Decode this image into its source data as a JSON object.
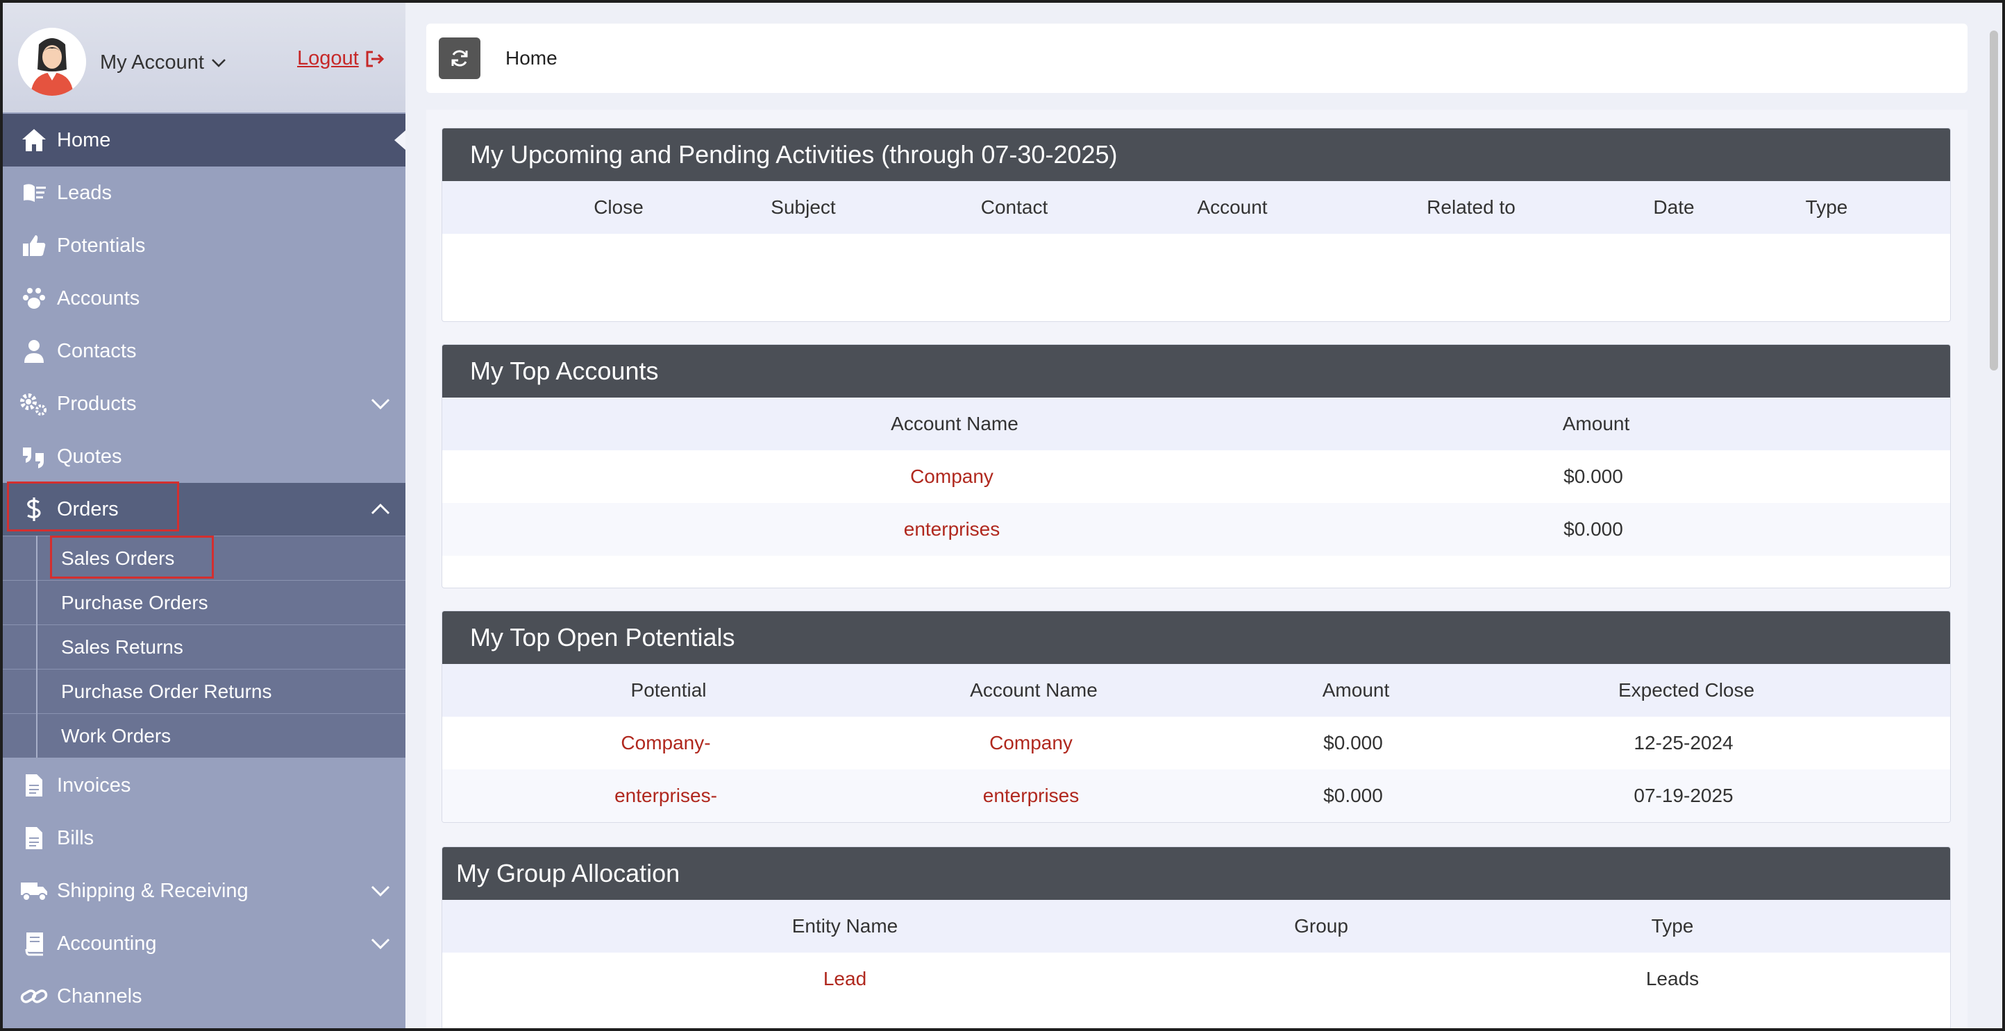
{
  "account": {
    "my_account_label": "My Account",
    "logout_label": "Logout"
  },
  "sidebar": {
    "items": [
      {
        "label": "Home",
        "icon": "home-icon"
      },
      {
        "label": "Leads",
        "icon": "leads-icon"
      },
      {
        "label": "Potentials",
        "icon": "thumbs-up-icon"
      },
      {
        "label": "Accounts",
        "icon": "paw-icon"
      },
      {
        "label": "Contacts",
        "icon": "person-icon"
      },
      {
        "label": "Products",
        "icon": "gears-icon"
      },
      {
        "label": "Quotes",
        "icon": "quote-icon"
      },
      {
        "label": "Orders",
        "icon": "dollar-icon"
      },
      {
        "label": "Invoices",
        "icon": "document-icon"
      },
      {
        "label": "Bills",
        "icon": "document-icon"
      },
      {
        "label": "Shipping & Receiving",
        "icon": "truck-icon"
      },
      {
        "label": "Accounting",
        "icon": "book-icon"
      },
      {
        "label": "Channels",
        "icon": "link-icon"
      }
    ],
    "orders_sub": [
      "Sales Orders",
      "Purchase Orders",
      "Sales Returns",
      "Purchase Order Returns",
      "Work Orders"
    ]
  },
  "breadcrumb": {
    "current": "Home"
  },
  "activities": {
    "title": "My Upcoming and Pending Activities (through 07-30-2025)",
    "columns": [
      "Close",
      "Subject",
      "Contact",
      "Account",
      "Related to",
      "Date",
      "Type"
    ]
  },
  "top_accounts": {
    "title": "My Top Accounts",
    "columns": [
      "Account Name",
      "Amount"
    ],
    "rows": [
      {
        "name": "Company",
        "amount": "$0.000"
      },
      {
        "name": "enterprises",
        "amount": "$0.000"
      }
    ]
  },
  "top_potentials": {
    "title": "My Top Open Potentials",
    "columns": [
      "Potential",
      "Account Name",
      "Amount",
      "Expected Close"
    ],
    "rows": [
      {
        "potential": "Company-",
        "account": "Company",
        "amount": "$0.000",
        "close": "12-25-2024"
      },
      {
        "potential": "enterprises-",
        "account": "enterprises",
        "amount": "$0.000",
        "close": "07-19-2025"
      }
    ]
  },
  "group_allocation": {
    "title": "My Group Allocation",
    "columns": [
      "Entity Name",
      "Group",
      "Type"
    ],
    "rows": [
      {
        "entity": "Lead",
        "group": "",
        "type": "Leads"
      }
    ]
  },
  "colors": {
    "accent_link": "#b0281e",
    "panel_header": "#4b4f56",
    "sidebar": "#97a0be",
    "highlight_box": "#d32f2f"
  }
}
